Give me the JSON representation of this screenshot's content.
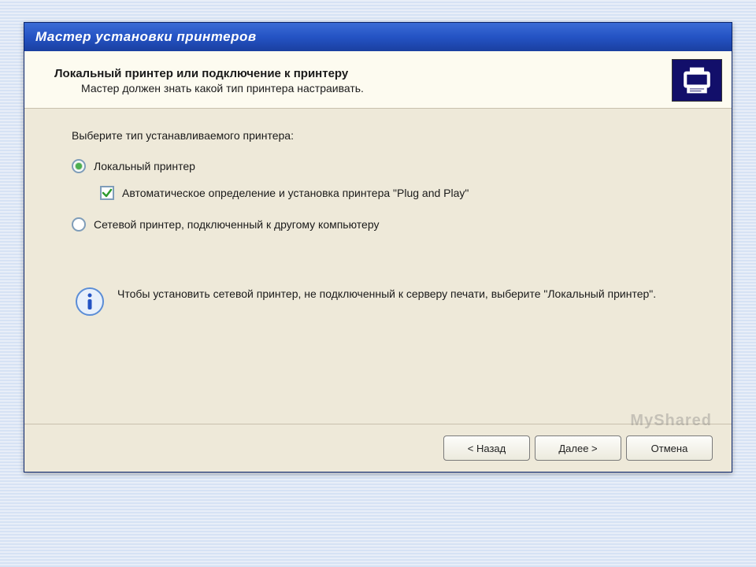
{
  "colors": {
    "titlebar_blue": "#2453c4",
    "icon_navy": "#120f6a",
    "radio_green": "#4caf50"
  },
  "icons": {
    "header": "printer-icon",
    "info": "info-icon",
    "check": "checkmark-icon"
  },
  "dialog": {
    "title": "Мастер установки принтеров",
    "header_title": "Локальный принтер или подключение к принтеру",
    "header_subtitle": "Мастер должен знать какой тип принтера настраивать.",
    "instruction": "Выберите тип устанавливаемого принтера:",
    "radios": {
      "local": {
        "label": "Локальный принтер",
        "selected": true
      },
      "network": {
        "label": "Сетевой принтер, подключенный к другому компьютеру",
        "selected": false
      }
    },
    "checkbox": {
      "label": "Автоматическое определение и установка принтера \"Plug and Play\"",
      "checked": true
    },
    "info": "Чтобы установить сетевой принтер, не подключенный к серверу печати, выберите \"Локальный принтер\".",
    "buttons": {
      "back": "< Назад",
      "next": "Далее >",
      "cancel": "Отмена"
    }
  },
  "watermark": "MyShared"
}
